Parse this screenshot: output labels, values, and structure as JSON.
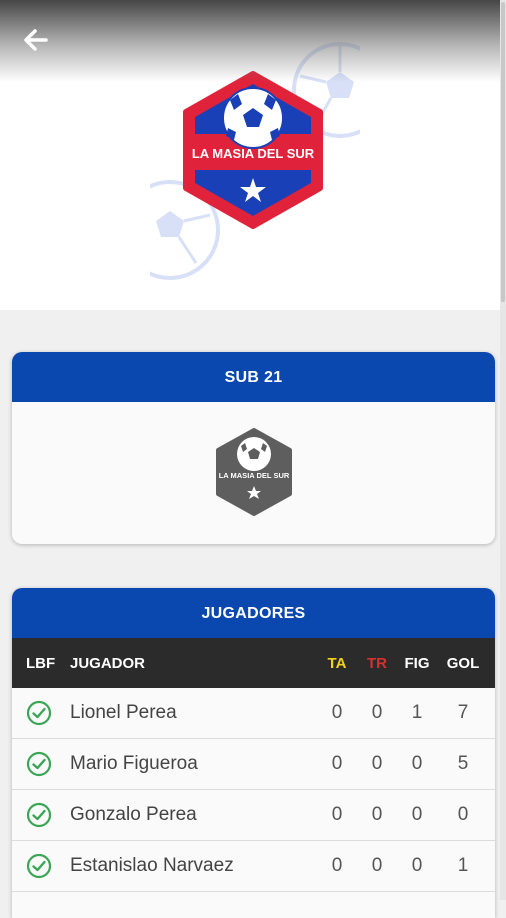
{
  "header": {
    "back_icon": "arrow-left-icon",
    "club_name": "LA MASIA DEL SUR"
  },
  "team_card": {
    "title": "SUB 21",
    "logo_text": "LA MASIA DEL SUR"
  },
  "players_card": {
    "title": "JUGADORES",
    "columns": {
      "lbf": "LBF",
      "player": "JUGADOR",
      "ta": "TA",
      "tr": "TR",
      "fig": "FIG",
      "gol": "GOL"
    },
    "rows": [
      {
        "status_icon": "check-circle-icon",
        "name": "Lionel Perea",
        "ta": "0",
        "tr": "0",
        "fig": "1",
        "gol": "7"
      },
      {
        "status_icon": "check-circle-icon",
        "name": "Mario Figueroa",
        "ta": "0",
        "tr": "0",
        "fig": "0",
        "gol": "5"
      },
      {
        "status_icon": "check-circle-icon",
        "name": "Gonzalo Perea",
        "ta": "0",
        "tr": "0",
        "fig": "0",
        "gol": "0"
      },
      {
        "status_icon": "check-circle-icon",
        "name": "Estanislao Narvaez",
        "ta": "0",
        "tr": "0",
        "fig": "0",
        "gol": "1"
      }
    ]
  },
  "colors": {
    "primary_blue": "#0a48b0",
    "logo_red": "#e0233a",
    "table_header": "#2b2b2b",
    "ta_yellow": "#f2d21b",
    "tr_red": "#d83030",
    "check_green": "#3aa655"
  }
}
